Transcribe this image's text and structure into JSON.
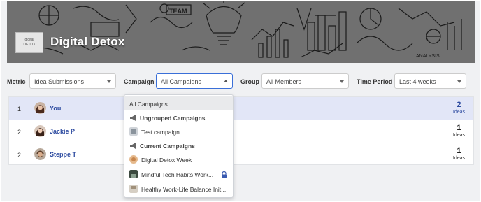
{
  "banner": {
    "title": "Digital Detox",
    "logo_lines": [
      "digital",
      "DETOX"
    ],
    "doodle_words": [
      "TEAM",
      "ANALYSIS"
    ]
  },
  "filters": {
    "metric": {
      "label": "Metric",
      "value": "Idea Submissions"
    },
    "campaign": {
      "label": "Campaign",
      "value": "All Campaigns"
    },
    "group": {
      "label": "Group",
      "value": "All Members"
    },
    "time_period": {
      "label": "Time Period",
      "value": "Last 4 weeks"
    }
  },
  "leaderboard": {
    "rows": [
      {
        "rank": "1",
        "name": "You",
        "count": "2",
        "unit": "Ideas"
      },
      {
        "rank": "2",
        "name": "Jackie P",
        "count": "1",
        "unit": "Ideas"
      },
      {
        "rank": "2",
        "name": "Steppe T",
        "count": "1",
        "unit": "Ideas"
      }
    ]
  },
  "campaign_dropdown": {
    "all": "All Campaigns",
    "ungrouped_header": "Ungrouped Campaigns",
    "ungrouped_items": [
      "Test campaign"
    ],
    "current_header": "Current Campaigns",
    "current_items": [
      "Digital Detox Week",
      "Mindful Tech Habits Work...",
      "Healthy Work-Life Balance Init..."
    ]
  },
  "colors": {
    "accent": "#3a6fd8",
    "link": "#2d4ba0",
    "highlight_row": "#e2e6f7"
  }
}
